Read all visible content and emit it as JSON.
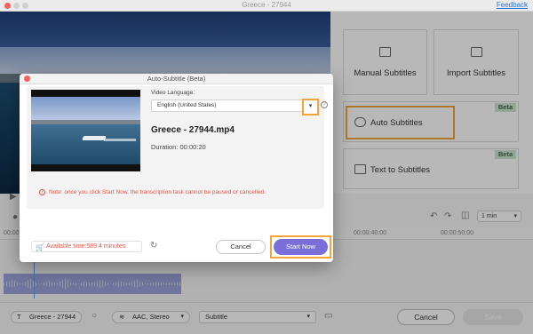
{
  "window": {
    "title": "Greece - 27944",
    "feedback_label": "Feedback"
  },
  "subtitle_options": {
    "manual_label": "Manual Subtitles",
    "import_label": "Import Subtitles",
    "auto_label": "Auto Subtitles",
    "auto_badge": "Beta",
    "text_to_sub_label": "Text to Subtitles",
    "text_to_sub_badge": "Beta"
  },
  "timeline": {
    "ruler_marks": [
      "00:00",
      "00:00:40:00",
      "00:00:50:00"
    ],
    "zoom_value": "1 min"
  },
  "bottom_bar": {
    "clip_select": "Greece - 27944",
    "audio_select": "AAC, Stereo",
    "subtitle_select": "Subtitle",
    "cancel_label": "Cancel",
    "save_label": "Save"
  },
  "dialog": {
    "title": "Auto-Subtitle (Beta)",
    "video_language_label": "Video Language:",
    "video_language_value": "English (United States)",
    "file_name": "Greece - 27944.mp4",
    "duration": "Duration: 00:00:20",
    "warning": "Note: once you click Start Now, the transcription task cannot be paused or cancelled.",
    "available_time": "Available time:589.4 minutes",
    "cancel_label": "Cancel",
    "start_label": "Start Now"
  },
  "colors": {
    "accent_purple": "#7a6fd9",
    "highlight_orange": "#f3a53b",
    "warning_red": "#e0584b",
    "beta_green": "#cfe7d4"
  }
}
